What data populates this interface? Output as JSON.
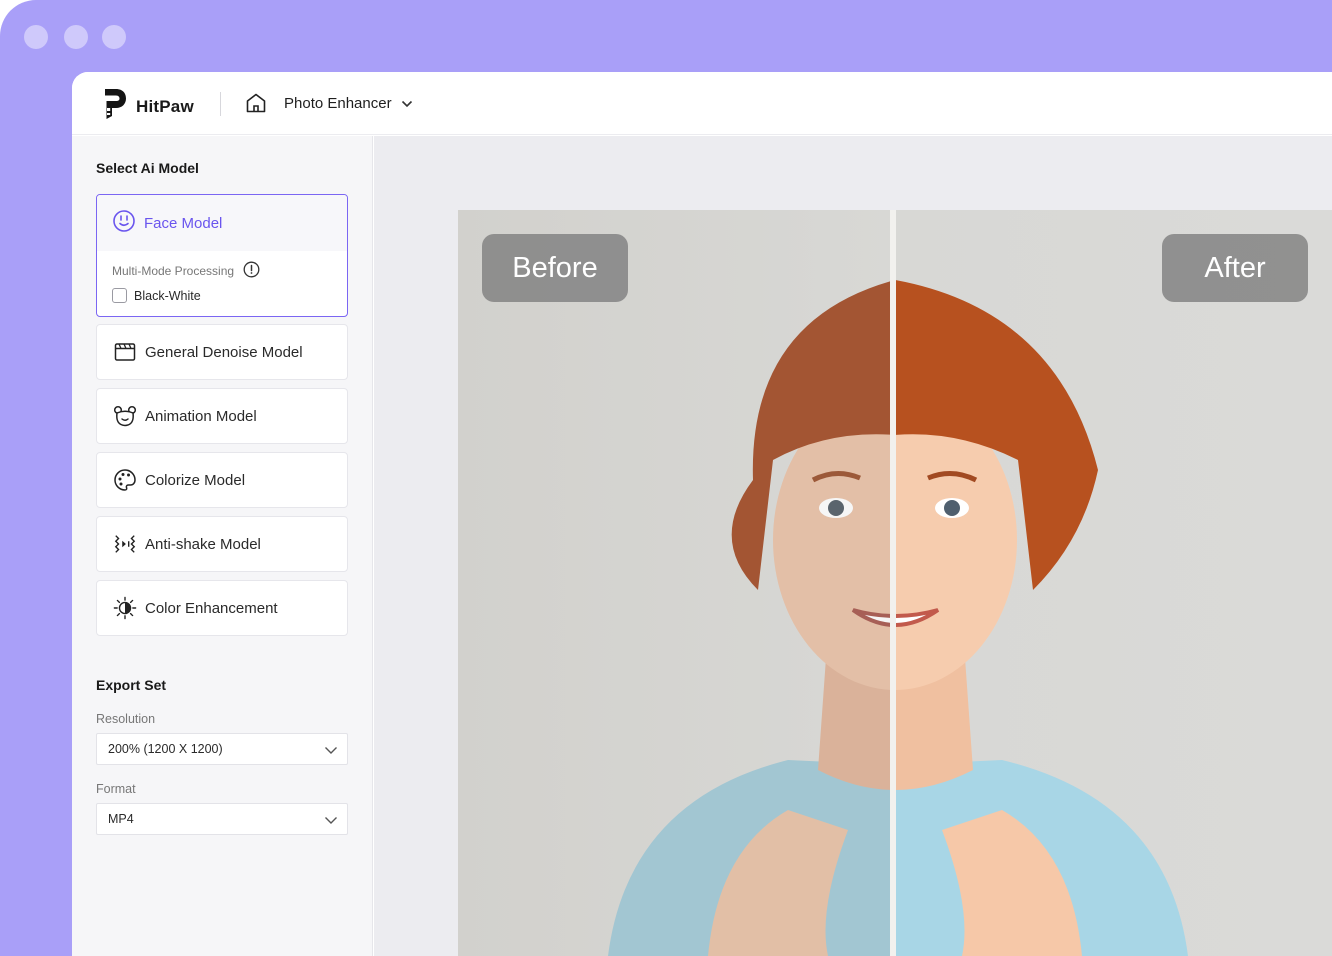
{
  "window": {
    "controls": [
      "dot",
      "dot",
      "dot"
    ]
  },
  "header": {
    "logo_text": "HitPaw",
    "title": "Photo Enhancer"
  },
  "sidebar": {
    "model_section_title": "Select Ai Model",
    "active_model": {
      "label": "Face Model",
      "icon": "face-icon",
      "multi_mode_label": "Multi-Mode Processing",
      "option_label": "Black-White",
      "option_checked": false
    },
    "models": [
      {
        "label": "General Denoise Model",
        "icon": "film-icon"
      },
      {
        "label": "Animation Model",
        "icon": "bear-icon"
      },
      {
        "label": "Colorize Model",
        "icon": "palette-icon"
      },
      {
        "label": "Anti-shake Model",
        "icon": "anti-shake-icon"
      },
      {
        "label": "Color Enhancement",
        "icon": "brightness-icon"
      }
    ],
    "export": {
      "title": "Export Set",
      "resolution_label": "Resolution",
      "resolution_value": "200% (1200 X 1200)",
      "format_label": "Format",
      "format_value": "MP4"
    }
  },
  "preview": {
    "before_label": "Before",
    "after_label": "After"
  },
  "colors": {
    "frame": "#a99ff8",
    "accent": "#6a55ee",
    "sidebar_bg": "#f6f6f8",
    "canvas_bg": "#ececf0"
  }
}
